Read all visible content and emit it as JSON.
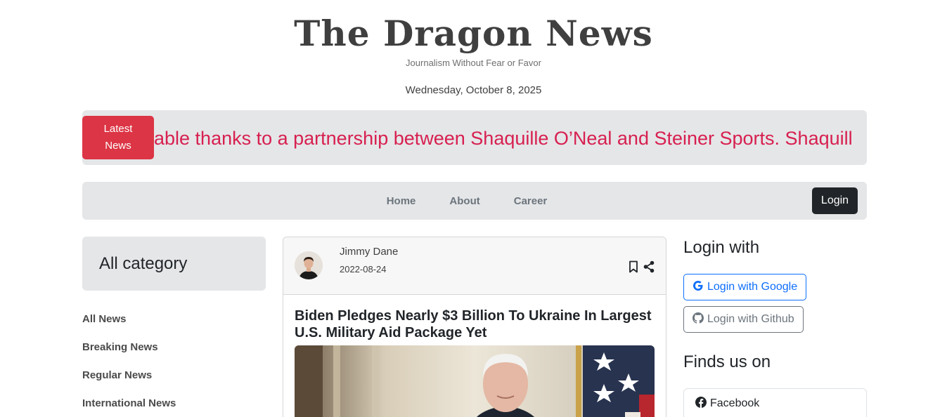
{
  "site": {
    "title": "The Dragon News",
    "tagline": "Journalism Without Fear or Favor",
    "date": "Wednesday, October 8, 2025"
  },
  "ticker": {
    "button_label": "Latest News",
    "text": "able thanks to a partnership between Shaquille O’Neal and Steiner Sports. Shaquill",
    "text_color": "#d72050",
    "button_color": "#dc3545"
  },
  "nav": {
    "links": [
      "Home",
      "About",
      "Career"
    ],
    "login_label": "Login"
  },
  "left": {
    "category_title": "All category",
    "categories": [
      "All News",
      "Breaking News",
      "Regular News",
      "International News"
    ]
  },
  "card": {
    "author": "Jimmy Dane",
    "date": "2022-08-24",
    "title": "Biden Pledges Nearly $3 Billion To Ukraine In Largest U.S. Military Aid Package Yet",
    "icons": [
      "bookmark-icon",
      "share-icon"
    ]
  },
  "right": {
    "login_title": "Login with",
    "google_label": "Login with Google",
    "github_label": "Login with Github",
    "find_title": "Finds us on",
    "socials": [
      "Facebook"
    ]
  }
}
